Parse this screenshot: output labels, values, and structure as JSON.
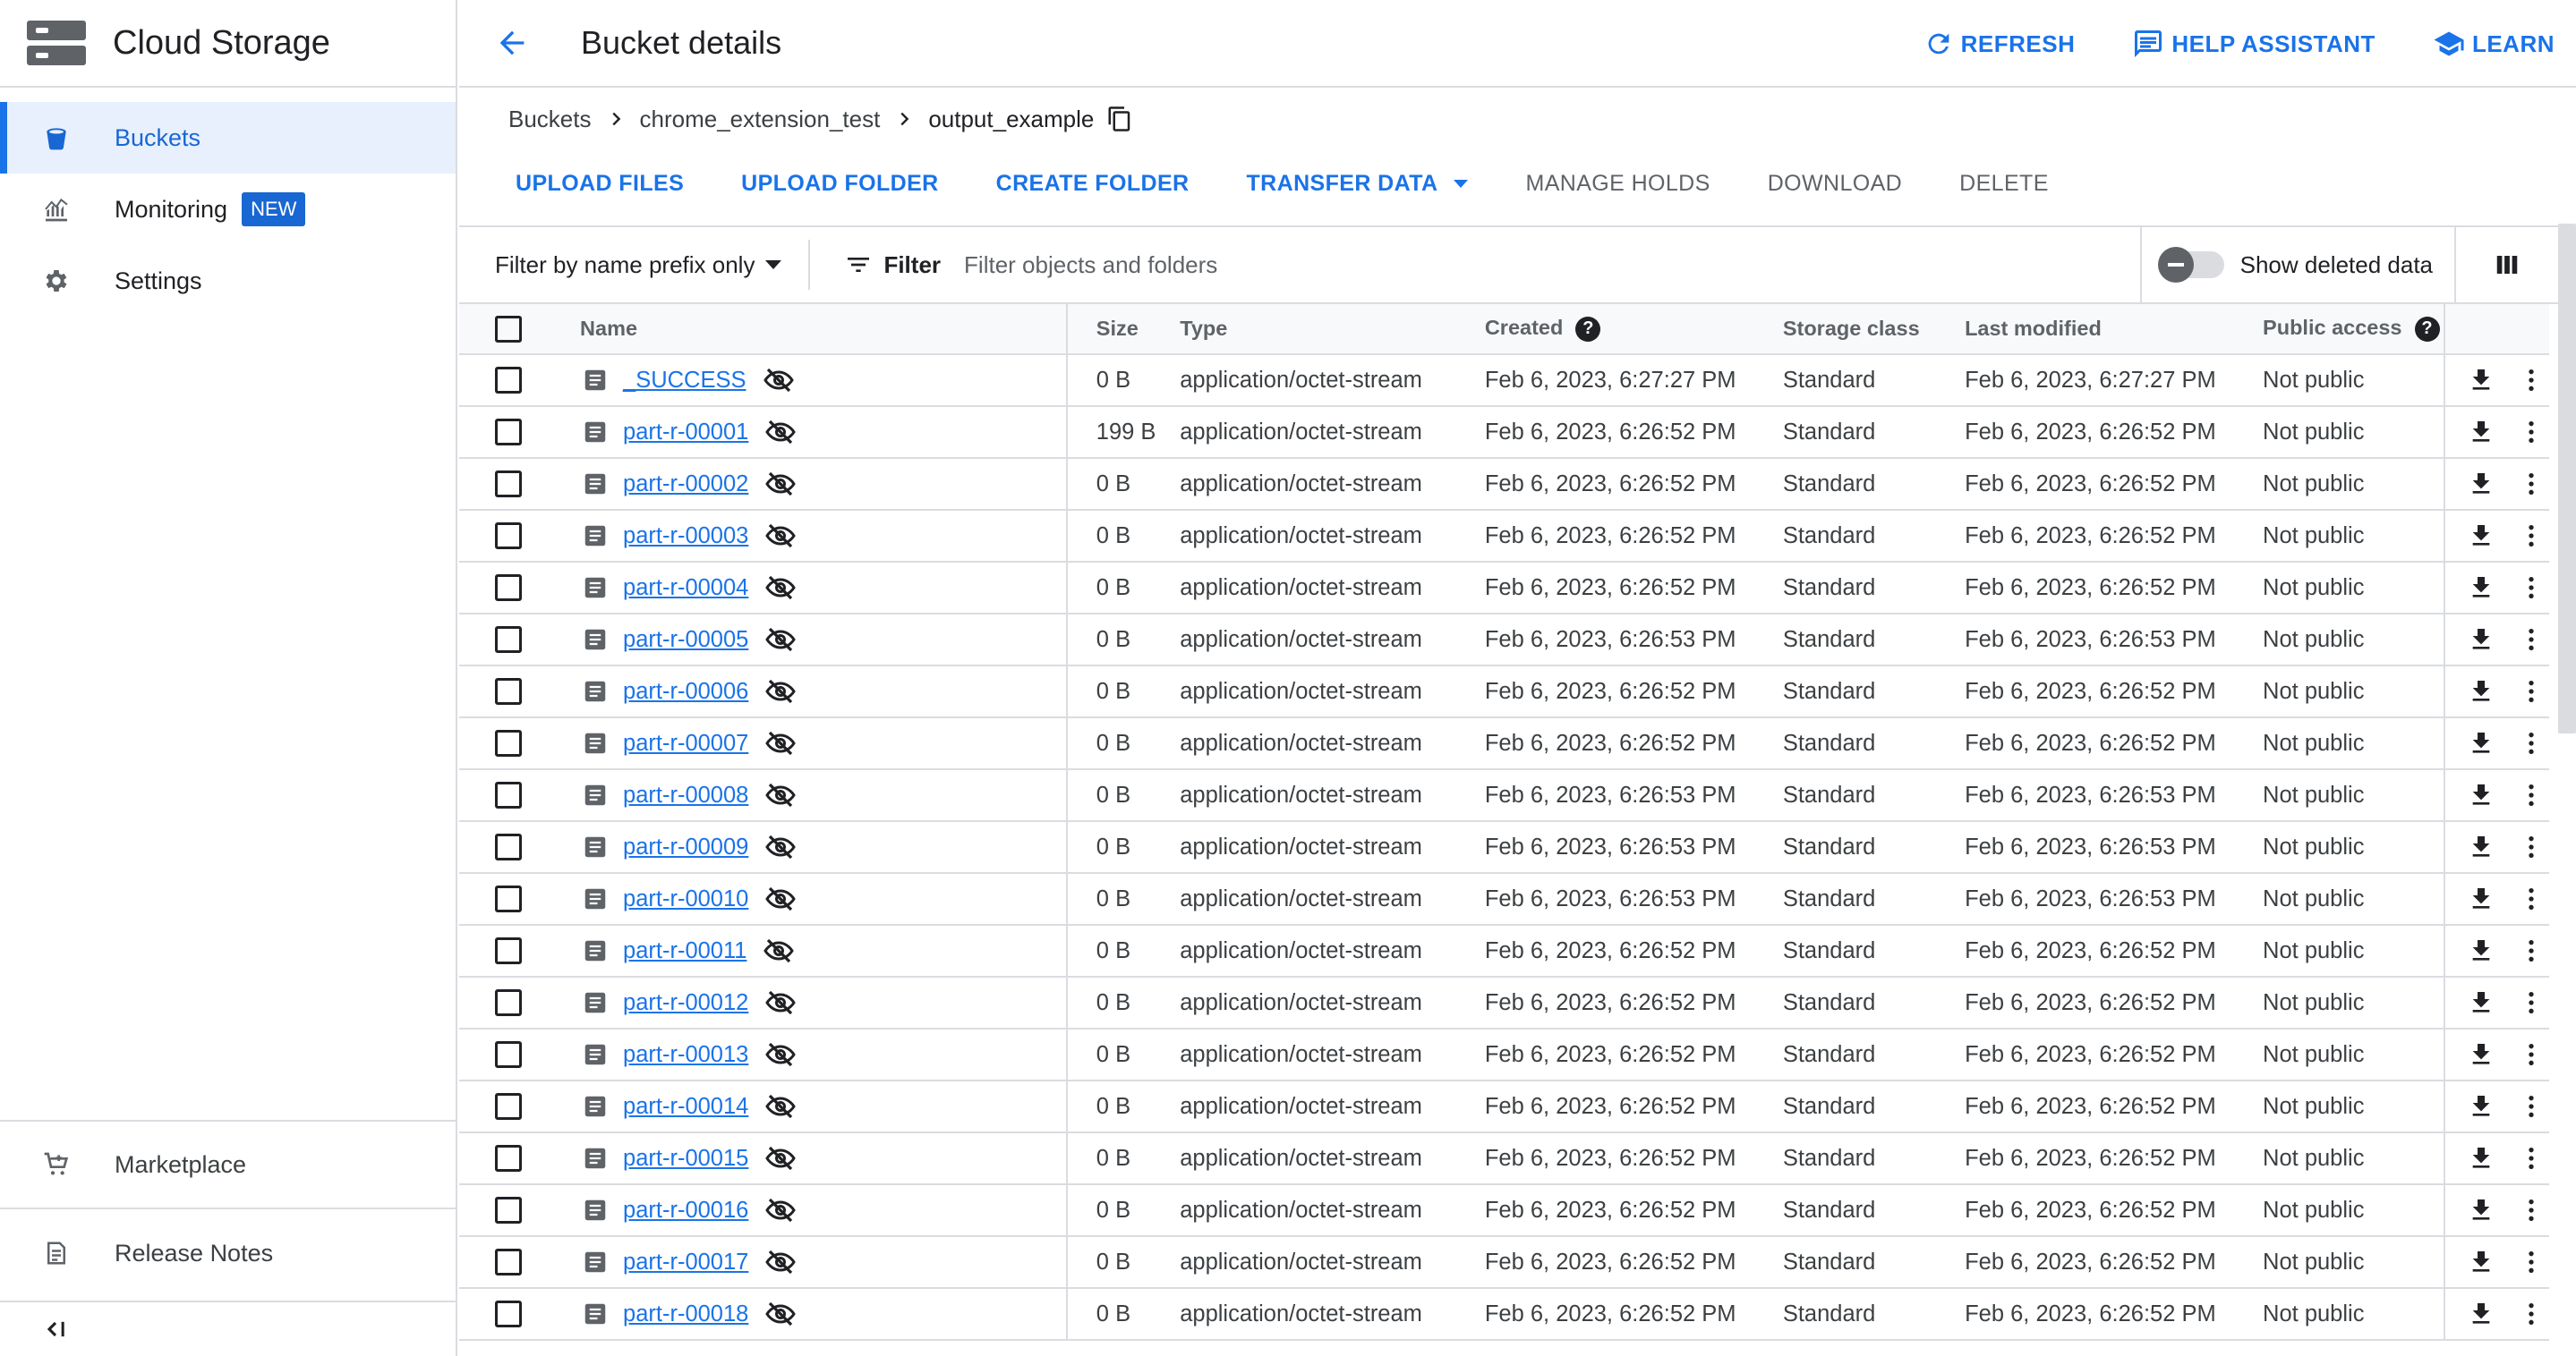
{
  "sidebar": {
    "product_title": "Cloud Storage",
    "product_icon": "storage-icon",
    "nav": [
      {
        "label": "Buckets",
        "icon": "bucket-icon",
        "active": true
      },
      {
        "label": "Monitoring",
        "icon": "monitoring-icon",
        "badge": "NEW"
      },
      {
        "label": "Settings",
        "icon": "gear-icon"
      }
    ],
    "bottom": [
      {
        "label": "Marketplace",
        "icon": "cart-icon"
      },
      {
        "label": "Release Notes",
        "icon": "notes-icon"
      }
    ],
    "collapse_icon": "collapse-icon"
  },
  "header": {
    "title": "Bucket details",
    "back_icon": "arrow-back-icon",
    "actions": [
      {
        "label": "REFRESH",
        "icon": "refresh-icon"
      },
      {
        "label": "HELP ASSISTANT",
        "icon": "chat-icon"
      },
      {
        "label": "LEARN",
        "icon": "school-icon"
      }
    ]
  },
  "breadcrumb": [
    "Buckets",
    "chrome_extension_test",
    "output_example"
  ],
  "toolbar": {
    "actions": [
      {
        "label": "UPLOAD FILES",
        "enabled": true
      },
      {
        "label": "UPLOAD FOLDER",
        "enabled": true
      },
      {
        "label": "CREATE FOLDER",
        "enabled": true
      },
      {
        "label": "TRANSFER DATA",
        "enabled": true,
        "dropdown": true
      },
      {
        "label": "MANAGE HOLDS",
        "enabled": false
      },
      {
        "label": "DOWNLOAD",
        "enabled": false
      },
      {
        "label": "DELETE",
        "enabled": false
      }
    ]
  },
  "filter": {
    "type_label": "Filter by name prefix only",
    "label": "Filter",
    "placeholder": "Filter objects and folders",
    "show_deleted_label": "Show deleted data"
  },
  "table": {
    "columns": [
      "Name",
      "Size",
      "Type",
      "Created",
      "Storage class",
      "Last modified",
      "Public access"
    ],
    "rows": [
      {
        "name": "_SUCCESS",
        "size": "0 B",
        "type": "application/octet-stream",
        "created": "Feb 6, 2023, 6:27:27 PM",
        "class": "Standard",
        "modified": "Feb 6, 2023, 6:27:27 PM",
        "public": "Not public"
      },
      {
        "name": "part-r-00001",
        "size": "199 B",
        "type": "application/octet-stream",
        "created": "Feb 6, 2023, 6:26:52 PM",
        "class": "Standard",
        "modified": "Feb 6, 2023, 6:26:52 PM",
        "public": "Not public"
      },
      {
        "name": "part-r-00002",
        "size": "0 B",
        "type": "application/octet-stream",
        "created": "Feb 6, 2023, 6:26:52 PM",
        "class": "Standard",
        "modified": "Feb 6, 2023, 6:26:52 PM",
        "public": "Not public"
      },
      {
        "name": "part-r-00003",
        "size": "0 B",
        "type": "application/octet-stream",
        "created": "Feb 6, 2023, 6:26:52 PM",
        "class": "Standard",
        "modified": "Feb 6, 2023, 6:26:52 PM",
        "public": "Not public"
      },
      {
        "name": "part-r-00004",
        "size": "0 B",
        "type": "application/octet-stream",
        "created": "Feb 6, 2023, 6:26:52 PM",
        "class": "Standard",
        "modified": "Feb 6, 2023, 6:26:52 PM",
        "public": "Not public"
      },
      {
        "name": "part-r-00005",
        "size": "0 B",
        "type": "application/octet-stream",
        "created": "Feb 6, 2023, 6:26:53 PM",
        "class": "Standard",
        "modified": "Feb 6, 2023, 6:26:53 PM",
        "public": "Not public"
      },
      {
        "name": "part-r-00006",
        "size": "0 B",
        "type": "application/octet-stream",
        "created": "Feb 6, 2023, 6:26:52 PM",
        "class": "Standard",
        "modified": "Feb 6, 2023, 6:26:52 PM",
        "public": "Not public"
      },
      {
        "name": "part-r-00007",
        "size": "0 B",
        "type": "application/octet-stream",
        "created": "Feb 6, 2023, 6:26:52 PM",
        "class": "Standard",
        "modified": "Feb 6, 2023, 6:26:52 PM",
        "public": "Not public"
      },
      {
        "name": "part-r-00008",
        "size": "0 B",
        "type": "application/octet-stream",
        "created": "Feb 6, 2023, 6:26:53 PM",
        "class": "Standard",
        "modified": "Feb 6, 2023, 6:26:53 PM",
        "public": "Not public"
      },
      {
        "name": "part-r-00009",
        "size": "0 B",
        "type": "application/octet-stream",
        "created": "Feb 6, 2023, 6:26:53 PM",
        "class": "Standard",
        "modified": "Feb 6, 2023, 6:26:53 PM",
        "public": "Not public"
      },
      {
        "name": "part-r-00010",
        "size": "0 B",
        "type": "application/octet-stream",
        "created": "Feb 6, 2023, 6:26:53 PM",
        "class": "Standard",
        "modified": "Feb 6, 2023, 6:26:53 PM",
        "public": "Not public"
      },
      {
        "name": "part-r-00011",
        "size": "0 B",
        "type": "application/octet-stream",
        "created": "Feb 6, 2023, 6:26:52 PM",
        "class": "Standard",
        "modified": "Feb 6, 2023, 6:26:52 PM",
        "public": "Not public"
      },
      {
        "name": "part-r-00012",
        "size": "0 B",
        "type": "application/octet-stream",
        "created": "Feb 6, 2023, 6:26:52 PM",
        "class": "Standard",
        "modified": "Feb 6, 2023, 6:26:52 PM",
        "public": "Not public"
      },
      {
        "name": "part-r-00013",
        "size": "0 B",
        "type": "application/octet-stream",
        "created": "Feb 6, 2023, 6:26:52 PM",
        "class": "Standard",
        "modified": "Feb 6, 2023, 6:26:52 PM",
        "public": "Not public"
      },
      {
        "name": "part-r-00014",
        "size": "0 B",
        "type": "application/octet-stream",
        "created": "Feb 6, 2023, 6:26:52 PM",
        "class": "Standard",
        "modified": "Feb 6, 2023, 6:26:52 PM",
        "public": "Not public"
      },
      {
        "name": "part-r-00015",
        "size": "0 B",
        "type": "application/octet-stream",
        "created": "Feb 6, 2023, 6:26:52 PM",
        "class": "Standard",
        "modified": "Feb 6, 2023, 6:26:52 PM",
        "public": "Not public"
      },
      {
        "name": "part-r-00016",
        "size": "0 B",
        "type": "application/octet-stream",
        "created": "Feb 6, 2023, 6:26:52 PM",
        "class": "Standard",
        "modified": "Feb 6, 2023, 6:26:52 PM",
        "public": "Not public"
      },
      {
        "name": "part-r-00017",
        "size": "0 B",
        "type": "application/octet-stream",
        "created": "Feb 6, 2023, 6:26:52 PM",
        "class": "Standard",
        "modified": "Feb 6, 2023, 6:26:52 PM",
        "public": "Not public"
      },
      {
        "name": "part-r-00018",
        "size": "0 B",
        "type": "application/octet-stream",
        "created": "Feb 6, 2023, 6:26:52 PM",
        "class": "Standard",
        "modified": "Feb 6, 2023, 6:26:52 PM",
        "public": "Not public"
      }
    ]
  },
  "colors": {
    "accent": "#1a73e8",
    "active_bg": "#e8f0fe",
    "border": "#dadce0",
    "badge": "#1967d2"
  }
}
